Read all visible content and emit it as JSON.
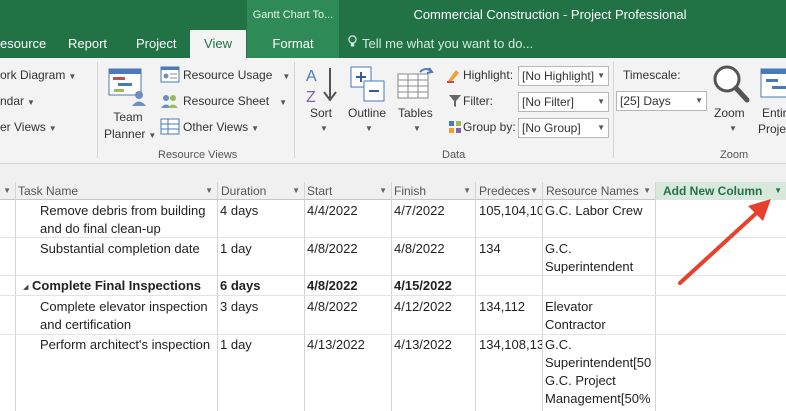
{
  "window": {
    "context_tab_header": "Gantt Chart To...",
    "title": "Commercial Construction - Project Professional"
  },
  "tabs": [
    {
      "label": "esource"
    },
    {
      "label": "Report"
    },
    {
      "label": "Project"
    },
    {
      "label": "View",
      "active": true
    },
    {
      "label": "Format"
    }
  ],
  "tell_me": {
    "icon": "lightbulb-icon",
    "text": "Tell me what you want to do..."
  },
  "ribbon": {
    "task_views": {
      "network_diagram": "ork Diagram",
      "calendar": "ndar",
      "other_views": "er Views"
    },
    "resource_views": {
      "team_planner": {
        "line1": "Team",
        "line2": "Planner"
      },
      "resource_usage": "Resource Usage",
      "resource_sheet": "Resource Sheet",
      "other_views": "Other Views",
      "group_label": "Resource Views"
    },
    "data": {
      "sort": "Sort",
      "outline": "Outline",
      "tables": "Tables",
      "highlight_label": "Highlight:",
      "highlight_value": "[No Highlight]",
      "filter_label": "Filter:",
      "filter_value": "[No Filter]",
      "group_by_label": "Group by:",
      "group_by_value": "[No Group]",
      "group_label": "Data"
    },
    "zoom": {
      "timescale_label": "Timescale:",
      "timescale_value": "[25] Days",
      "zoom": "Zoom",
      "entire_project": {
        "line1": "Entir",
        "line2": "Proje"
      },
      "group_label": "Zoom"
    }
  },
  "grid": {
    "columns": {
      "task_name": "Task Name",
      "duration": "Duration",
      "start": "Start",
      "finish": "Finish",
      "predecessors": "Predeces",
      "resource_names": "Resource Names",
      "add_new": "Add New Column"
    },
    "rows": [
      {
        "task_line1": "Remove debris from building",
        "task_line2": "and do final clean-up",
        "duration": "4 days",
        "start": "4/4/2022",
        "finish": "4/7/2022",
        "predecessors": "105,104,10",
        "resources_line1": "G.C. Labor Crew",
        "resources_line2": "",
        "summary": false
      },
      {
        "task_line1": "Substantial completion date",
        "task_line2": "",
        "duration": "1 day",
        "start": "4/8/2022",
        "finish": "4/8/2022",
        "predecessors": "134",
        "resources_line1": "G.C.",
        "resources_line2": "Superintendent",
        "summary": false
      },
      {
        "task_line1": "Complete Final Inspections",
        "task_line2": "",
        "duration": "6 days",
        "start": "4/8/2022",
        "finish": "4/15/2022",
        "predecessors": "",
        "resources_line1": "",
        "resources_line2": "",
        "summary": true
      },
      {
        "task_line1": "Complete elevator inspection",
        "task_line2": "and certification",
        "duration": "3 days",
        "start": "4/8/2022",
        "finish": "4/12/2022",
        "predecessors": "134,112",
        "resources_line1": "Elevator",
        "resources_line2": "Contractor",
        "summary": false
      },
      {
        "task_line1": "Perform architect's inspection",
        "task_line2": "",
        "duration": "1 day",
        "start": "4/13/2022",
        "finish": "4/13/2022",
        "predecessors": "134,108,13",
        "resources_line1": "G.C.",
        "resources_line2": "Superintendent[50",
        "resources_line3": "G.C. Project",
        "resources_line4": "Management[50%",
        "summary": false
      }
    ]
  },
  "annotation": {
    "type": "arrow",
    "color": "#e8412b",
    "points_to": "add-new-column-dropdown"
  },
  "colors": {
    "accent": "#217346",
    "context_tab": "#2e8b57",
    "add_column_bg": "#d8e8dc",
    "ribbon_bg": "#f3f3f3"
  }
}
